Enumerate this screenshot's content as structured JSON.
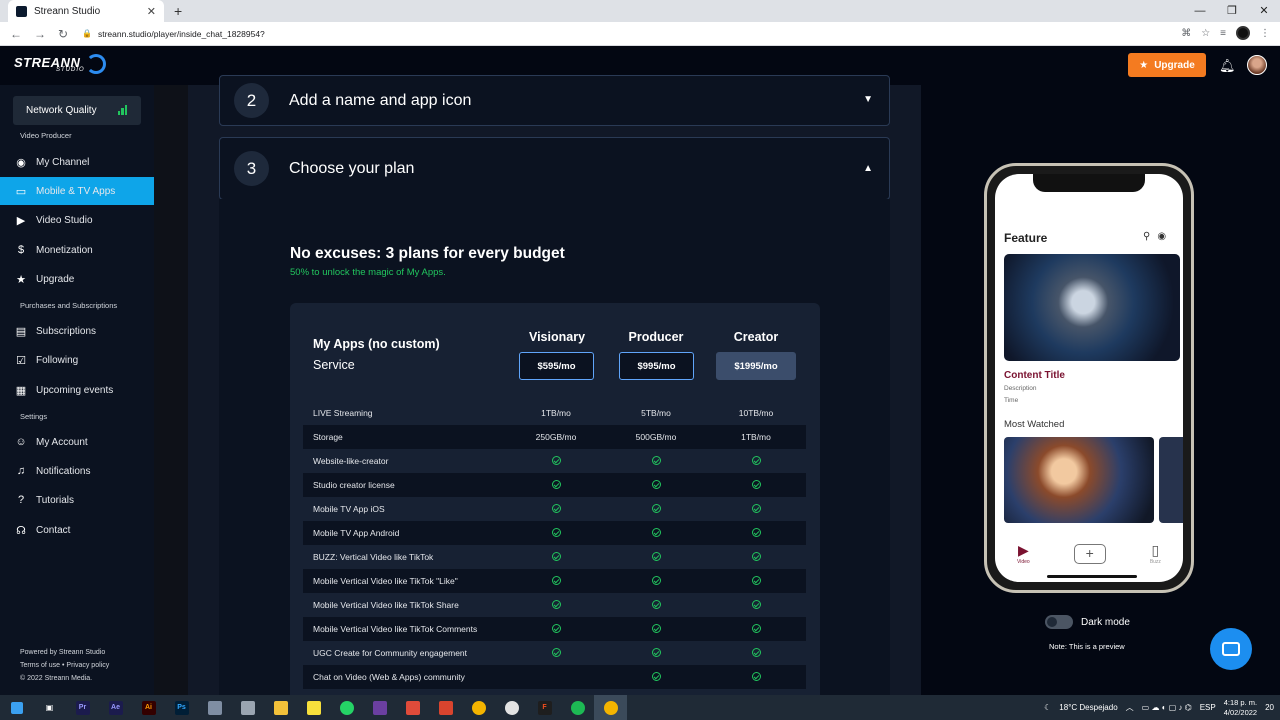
{
  "browser": {
    "tab_title": "Streann Studio",
    "url": "streann.studio/player/inside_chat_1828954?"
  },
  "header": {
    "logo_text": "STREANN",
    "logo_sub": "STUDIO",
    "upgrade_label": "Upgrade"
  },
  "sidebar": {
    "network_quality": "Network Quality",
    "section_video_producer": "Video Producer",
    "items_top": [
      {
        "label": "My Channel",
        "icon": "user-circle-icon"
      },
      {
        "label": "Mobile & TV Apps",
        "icon": "devices-icon"
      },
      {
        "label": "Video Studio",
        "icon": "video-icon"
      },
      {
        "label": "Monetization",
        "icon": "dollar-icon"
      },
      {
        "label": "Upgrade",
        "icon": "star-icon"
      }
    ],
    "section_purchases": "Purchases and Subscriptions",
    "items_mid": [
      {
        "label": "Subscriptions",
        "icon": "subscriptions-icon"
      },
      {
        "label": "Following",
        "icon": "following-icon"
      },
      {
        "label": "Upcoming events",
        "icon": "calendar-icon"
      }
    ],
    "section_settings": "Settings",
    "items_bottom": [
      {
        "label": "My Account",
        "icon": "smile-icon"
      },
      {
        "label": "Notifications",
        "icon": "bell-icon"
      },
      {
        "label": "Tutorials",
        "icon": "help-icon"
      },
      {
        "label": "Contact",
        "icon": "headset-icon"
      }
    ],
    "footer": {
      "powered": "Powered by Streann Studio",
      "terms": "Terms of use • Privacy policy",
      "copyright": "© 2022 Streann Media."
    }
  },
  "steps": [
    {
      "num": "2",
      "title": "Add a name and app icon"
    },
    {
      "num": "3",
      "title": "Choose your plan"
    }
  ],
  "plans": {
    "heading": "No excuses: 3 plans for every budget",
    "subheading": "50% to unlock the magic of My Apps.",
    "card_title": "My Apps (no custom)",
    "card_service": "Service",
    "columns": [
      {
        "name": "Visionary",
        "price": "$595/mo"
      },
      {
        "name": "Producer",
        "price": "$995/mo"
      },
      {
        "name": "Creator",
        "price": "$1995/mo"
      }
    ],
    "rows": [
      {
        "label": "LIVE Streaming",
        "values": [
          "1TB/mo",
          "5TB/mo",
          "10TB/mo"
        ]
      },
      {
        "label": "Storage",
        "values": [
          "250GB/mo",
          "500GB/mo",
          "1TB/mo"
        ]
      },
      {
        "label": "Website-like-creator",
        "values": [
          "check",
          "check",
          "check"
        ]
      },
      {
        "label": "Studio creator license",
        "values": [
          "check",
          "check",
          "check"
        ]
      },
      {
        "label": "Mobile TV App iOS",
        "values": [
          "check",
          "check",
          "check"
        ]
      },
      {
        "label": "Mobile TV App Android",
        "values": [
          "check",
          "check",
          "check"
        ]
      },
      {
        "label": "BUZZ: Vertical Video like TikTok",
        "values": [
          "check",
          "check",
          "check"
        ]
      },
      {
        "label": "Mobile Vertical Video like TikTok \"Like\"",
        "values": [
          "check",
          "check",
          "check"
        ]
      },
      {
        "label": "Mobile Vertical Video like TikTok Share",
        "values": [
          "check",
          "check",
          "check"
        ]
      },
      {
        "label": "Mobile Vertical Video like TikTok Comments",
        "values": [
          "check",
          "check",
          "check"
        ]
      },
      {
        "label": "UGC Create for Community engagement",
        "values": [
          "check",
          "check",
          "check"
        ]
      },
      {
        "label": "Chat on Video (Web & Apps) community",
        "values": [
          "",
          "check",
          "check"
        ]
      }
    ]
  },
  "preview": {
    "feature_title": "Feature",
    "content_title": "Content Title",
    "description": "Description",
    "time": "Time",
    "most_watched": "Most Watched",
    "tab_video": "Video",
    "tab_buzz": "Buzz",
    "dark_mode": "Dark mode",
    "note": "Note: This is a preview"
  },
  "taskbar": {
    "weather": "18°C  Despejado",
    "lang": "ESP",
    "time": "4:18 p. m.",
    "date": "4/02/2022",
    "notif_count": "20"
  }
}
